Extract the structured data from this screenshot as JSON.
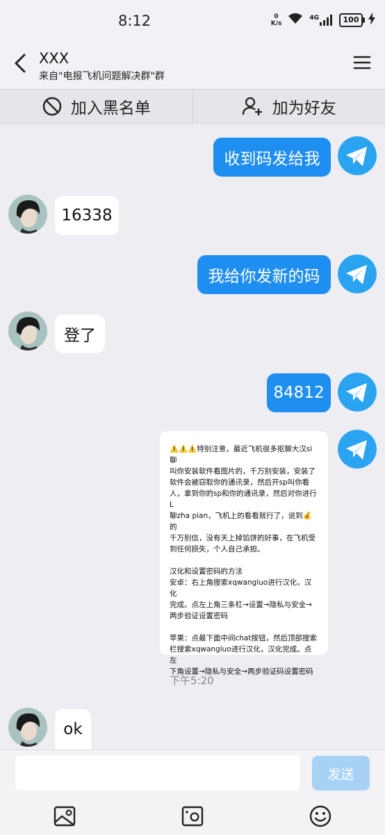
{
  "status_bar": {
    "time": "8:12",
    "net_speed_value": "0",
    "net_speed_unit": "K/s",
    "network": "4G",
    "battery": "100"
  },
  "header": {
    "name": "XXX",
    "source": "来自\"电报飞机问题解决群\"群"
  },
  "actions": {
    "block_label": "加入黑名单",
    "add_friend_label": "加为好友"
  },
  "messages": [
    {
      "direction": "out",
      "text": "收到码发给我"
    },
    {
      "direction": "in",
      "text": "16338"
    },
    {
      "direction": "out",
      "text": "我给你发新的码"
    },
    {
      "direction": "in",
      "text": "登了"
    },
    {
      "direction": "out",
      "text": "84812"
    },
    {
      "direction": "out",
      "type": "image"
    },
    {
      "direction": "in",
      "text": "ok"
    }
  ],
  "image_message": {
    "lines": [
      "⚠️⚠️⚠️特别注意，最近飞机很多抠脚大汉si聊",
      "叫你安装软件看图片的，千万别安装，安装了",
      "软件会被窃取你的通讯录，然后开sp叫你看",
      "人，拿到你的sp和你的通讯录，然后对你进行L",
      "聊zha pian，飞机上的看看就行了，说到💰的",
      "千万别信，没有天上掉馅饼的好事，在飞机受",
      "到任何损失，个人自己承担。",
      "",
      "汉化和设置密码的方法",
      "安卓：右上角搜索xqwangluo进行汉化，汉化",
      "完成。点左上角三条杠→设置→隐私与安全→",
      "两步验证设置密码",
      "",
      "苹果：点最下面中间chat按钮，然后顶部搜索",
      "栏搜索xqwangluo进行汉化，汉化完成。点左",
      "下角设置→隐私与安全→两步验证码设置密码"
    ]
  },
  "timestamp": "下午5:20",
  "input": {
    "value": "",
    "placeholder": "",
    "send_label": "发送"
  },
  "colors": {
    "accent": "#1f8ef1",
    "background": "#ededf2",
    "send_disabled": "#a7d2f6"
  },
  "icons": [
    "back-arrow-icon",
    "menu-icon",
    "block-icon",
    "add-friend-icon",
    "telegram-plane-icon",
    "image-icon",
    "camera-icon",
    "emoji-icon"
  ]
}
